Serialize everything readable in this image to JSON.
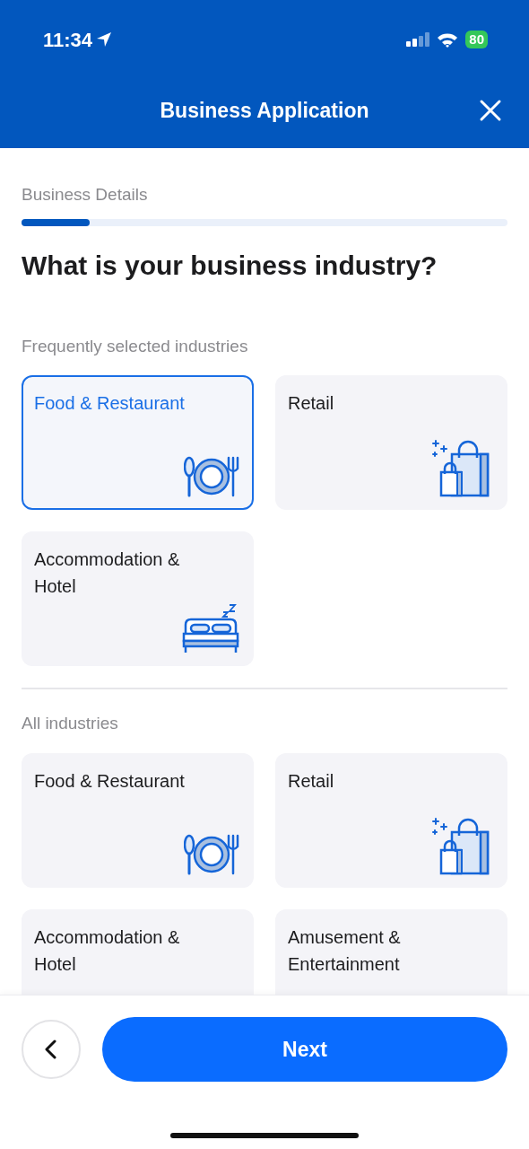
{
  "status_bar": {
    "time": "11:34",
    "battery": "80"
  },
  "header": {
    "title": "Business Application"
  },
  "step": {
    "label": "Business Details",
    "level": 0.14
  },
  "question": "What is your business industry?",
  "sections": [
    {
      "title": "Frequently selected industries",
      "items": [
        {
          "label": "Food & Restaurant",
          "kind": "food",
          "selected": true
        },
        {
          "label": "Retail",
          "kind": "retail",
          "selected": false
        },
        {
          "label": "Accommodation & Hotel",
          "kind": "hotel",
          "selected": false
        }
      ]
    },
    {
      "title": "All industries",
      "items": [
        {
          "label": "Food & Restaurant",
          "kind": "food",
          "selected": false
        },
        {
          "label": "Retail",
          "kind": "retail",
          "selected": false
        },
        {
          "label": "Accommodation & Hotel",
          "kind": "hotel",
          "selected": false
        },
        {
          "label": "Amusement & Entertainment",
          "kind": "amusement",
          "selected": false
        }
      ]
    }
  ],
  "footer": {
    "next": "Next"
  }
}
